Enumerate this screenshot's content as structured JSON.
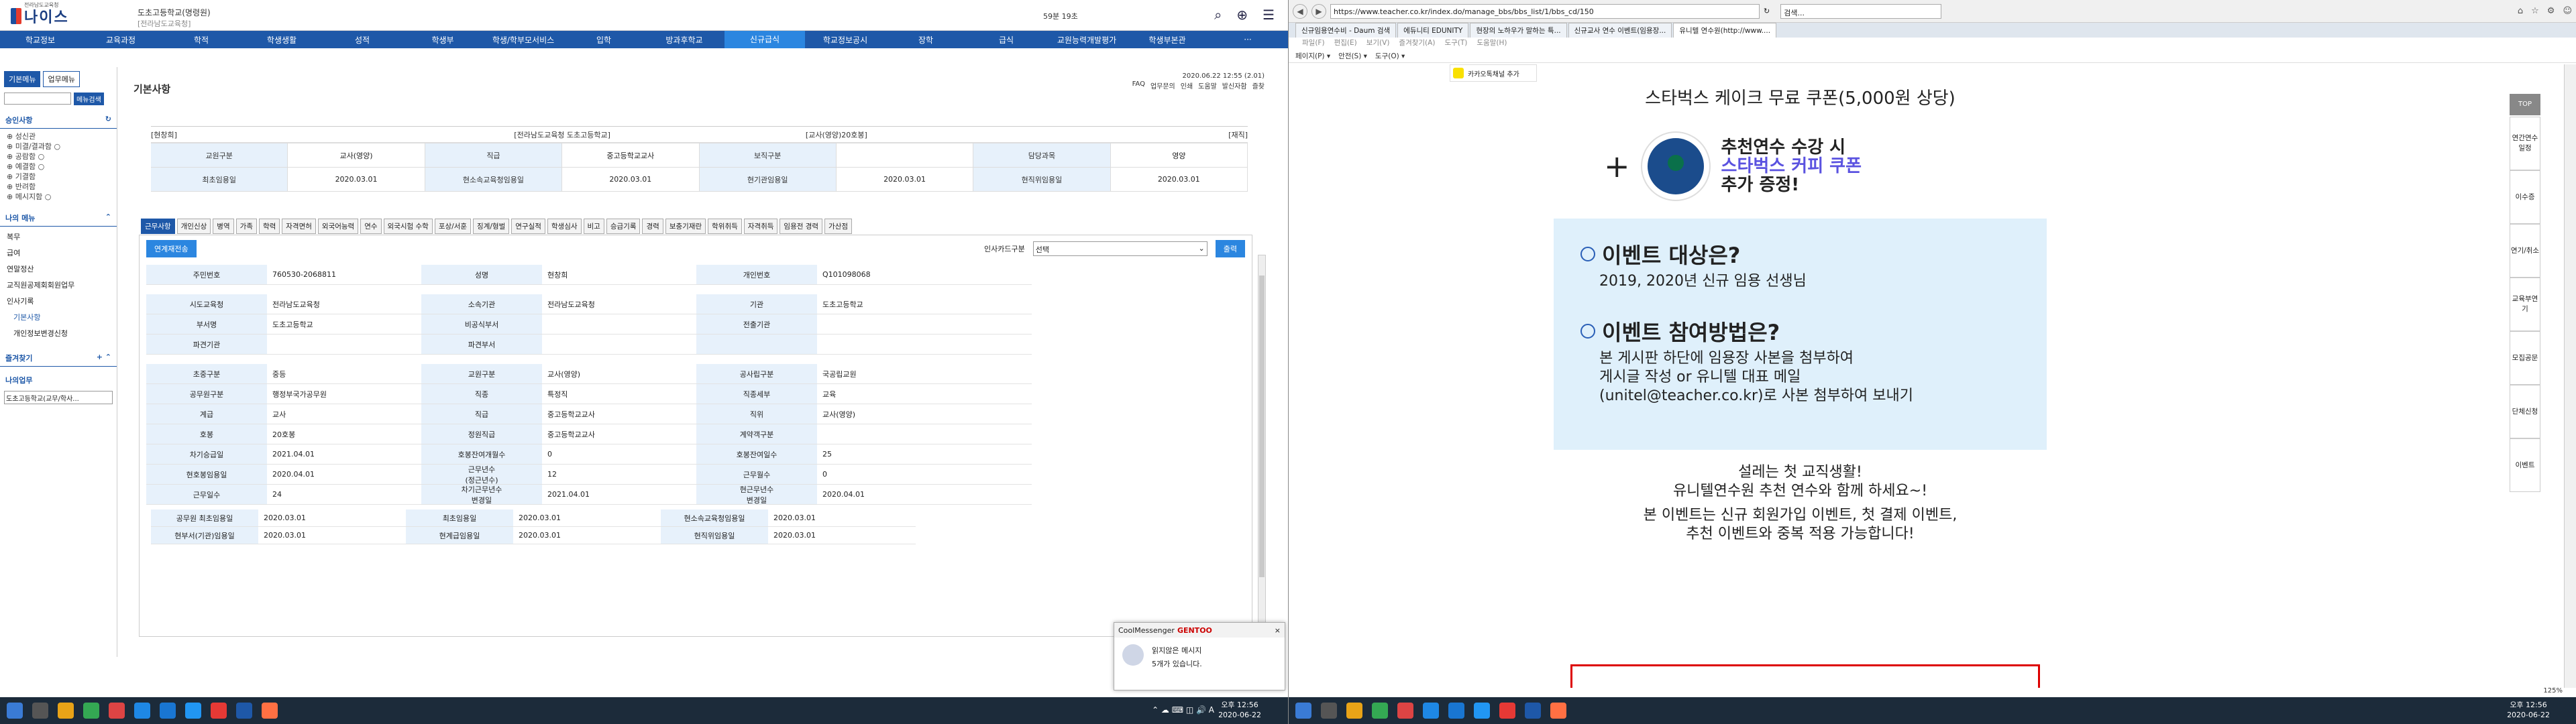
{
  "neis": {
    "logo_sub": "전라남도교육청",
    "logo_text": "나이스",
    "school_name": "도초고등학교(명령원)",
    "school_sub": "[전라남도교육청]",
    "timer": "59분 19초",
    "nav": [
      "학교정보",
      "교육과정",
      "학적",
      "학생생활",
      "성적",
      "학생부",
      "학생/학부모서비스",
      "입학",
      "방과후학교",
      "신규급식",
      "학교정보공시",
      "장학",
      "급식",
      "교원능력개발평가",
      "학생부본관",
      "···"
    ],
    "nav_active_index": 9,
    "sidebar": {
      "tabs": [
        "기본메뉴",
        "업무메뉴"
      ],
      "search_btn": "메뉴검색",
      "section1": "승인사항",
      "items": [
        "⊕ 성신관",
        "⊕ 미결/결과함 ○",
        "⊕ 공람함 ○",
        "⊕ 예결함 ○",
        "⊕ 기결함",
        "⊕ 반려함",
        "⊕ 메시지함 ○"
      ],
      "section2": "나의 메뉴",
      "mymenu": [
        "복무",
        "급여",
        "연말정산",
        "교직원공제회회원업무",
        "인사기록",
        "기본사항",
        "개인정보변경신청"
      ],
      "section3": "즐겨찾기",
      "section4": "나의업무",
      "select": "도초고등학교(교무/학사..."
    },
    "page_title": "기본사항",
    "updated": "2020.06.22 12:55 (2.01)",
    "top_links": [
      "FAQ",
      "업무문의",
      "인쇄",
      "도움말",
      "발신자함",
      "즐찾"
    ],
    "info_row": [
      "[현창희]",
      "[전라남도교육청 도초고등학교]",
      "[교사(영양)20호봉]",
      "[재직]"
    ],
    "info_grid": [
      [
        "교원구분",
        "교사(영양)",
        "직급",
        "중고등학교교사",
        "보직구분",
        "",
        "담당과목",
        "영양"
      ],
      [
        "최초임용일",
        "2020.03.01",
        "현소속교육청임용일",
        "2020.03.01",
        "현기관임용일",
        "2020.03.01",
        "현직위임용일",
        "2020.03.01"
      ]
    ],
    "tabs": [
      "근무사항",
      "개인신상",
      "병역",
      "가족",
      "학력",
      "자격면허",
      "외국어능력",
      "연수",
      "외국시험 수학",
      "포상/서훈",
      "징계/형벌",
      "연구실적",
      "학생심사",
      "비고",
      "승급기록",
      "경력",
      "보충기재란",
      "학위취득",
      "자격취득",
      "임용전 경력",
      "가산점"
    ],
    "detail": {
      "btn_left": "연계재전송",
      "select_label": "인사카드구분",
      "select_value": "선택",
      "btn_query": "출력",
      "rows": [
        [
          "주민번호",
          "760530-2068811",
          "성명",
          "현창희",
          "개인번호",
          "Q101098068"
        ],
        [
          "",
          "",
          "",
          "",
          "",
          ""
        ],
        [
          "시도교육청",
          "전라남도교육청",
          "소속기관",
          "전라남도교육청",
          "기관",
          "도초고등학교"
        ],
        [
          "부서명",
          "도초고등학교",
          "비공식부서",
          "",
          "전출기관",
          ""
        ],
        [
          "파견기관",
          "",
          "파견부서",
          "",
          "",
          ""
        ],
        [
          "",
          "",
          "",
          "",
          "",
          ""
        ],
        [
          "초중구분",
          "중등",
          "교원구분",
          "교사(영양)",
          "공사립구분",
          "국공립교원"
        ],
        [
          "공무원구분",
          "행정부국가공무원",
          "직종",
          "특정직",
          "직종세부",
          "교육"
        ],
        [
          "계급",
          "교사",
          "직급",
          "중고등학교교사",
          "직위",
          "교사(영양)"
        ],
        [
          "호봉",
          "20호봉",
          "정원직급",
          "중고등학교교사",
          "계약객구분",
          ""
        ],
        [
          "차기승급일",
          "2021.04.01",
          "호봉잔여개월수",
          "0",
          "호봉잔여일수",
          "25"
        ],
        [
          "현호봉임용일",
          "2020.04.01",
          "근무년수\n(정근년수)",
          "12",
          "근무월수",
          "0"
        ],
        [
          "근무일수",
          "24",
          "차기근무년수\n변경일",
          "2021.04.01",
          "현근무년수\n변경일",
          "2020.04.01"
        ]
      ],
      "bottom_rows": [
        [
          "공무원 최초임용일",
          "2020.03.01",
          "최초임용일",
          "2020.03.01",
          "현소속교육청임용일",
          "2020.03.01"
        ],
        [
          "현부서(기관)임용일",
          "2020.03.01",
          "현계급임용일",
          "2020.03.01",
          "현직위임용일",
          "2020.03.01"
        ]
      ]
    },
    "messenger": {
      "brand": "CoolMessenger",
      "product": "GENTOO",
      "line1": "읽지않은 메시지",
      "line2": "5개가 있습니다."
    }
  },
  "taskbar": {
    "time_left": "오후 12:56",
    "date_left": "2020-06-22",
    "time_right": "오후 12:56",
    "date_right": "2020-06-22"
  },
  "browser": {
    "url": "https://www.teacher.co.kr/index.do/manage_bbs/bbs_list/1/bbs_cd/150",
    "search_placeholder": "검색...",
    "tabs": [
      "신규임용연수비 - Daum 검색",
      "에듀니티 EDUNITY",
      "현장의 노하우가 말하는 특...",
      "신규교사 연수 이벤트(임용장...",
      "유니텔 연수원(http://www...."
    ],
    "active_tab": 4,
    "menu": [
      "파일(F)",
      "편집(E)",
      "보기(V)",
      "즐겨찾기(A)",
      "도구(T)",
      "도움말(H)"
    ],
    "tools": [
      "페이지(P) ▾",
      "안전(S) ▾",
      "도구(O) ▾"
    ],
    "kakao": "카카오톡채널 추가",
    "promo_top": "스타벅스 케이크 무료 쿠폰(5,000원 상당)",
    "cup_line1": "추천연수 수강 시",
    "cup_line2": "스타벅스 커피 쿠폰",
    "cup_line3": "추가 증정!",
    "event_target_title": "이벤트 대상은?",
    "event_target_text": "2019, 2020년 신규 임용 선생님",
    "event_method_title": "이벤트 참여방법은?",
    "event_method_text": [
      "본 게시판 하단에 임용장 사본을 첨부하여",
      "게시글 작성 or 유니텔 대표 메일",
      "(unitel@teacher.co.kr)로 사본 첨부하여 보내기"
    ],
    "tail": [
      "설레는 첫 교직생활!",
      "유니텔연수원 추천 연수와 함께 하세요~!",
      "본 이벤트는 신규 회원가입 이벤트, 첫 결제 이벤트,",
      "추천 이벤트와 중복 적용 가능합니다!"
    ],
    "right_nav": [
      "TOP",
      "연간연수\n일정",
      "이수증",
      "연기/취소",
      "교육부연기",
      "모집공문",
      "단체신청",
      "이벤트"
    ],
    "zoom": "125%"
  }
}
